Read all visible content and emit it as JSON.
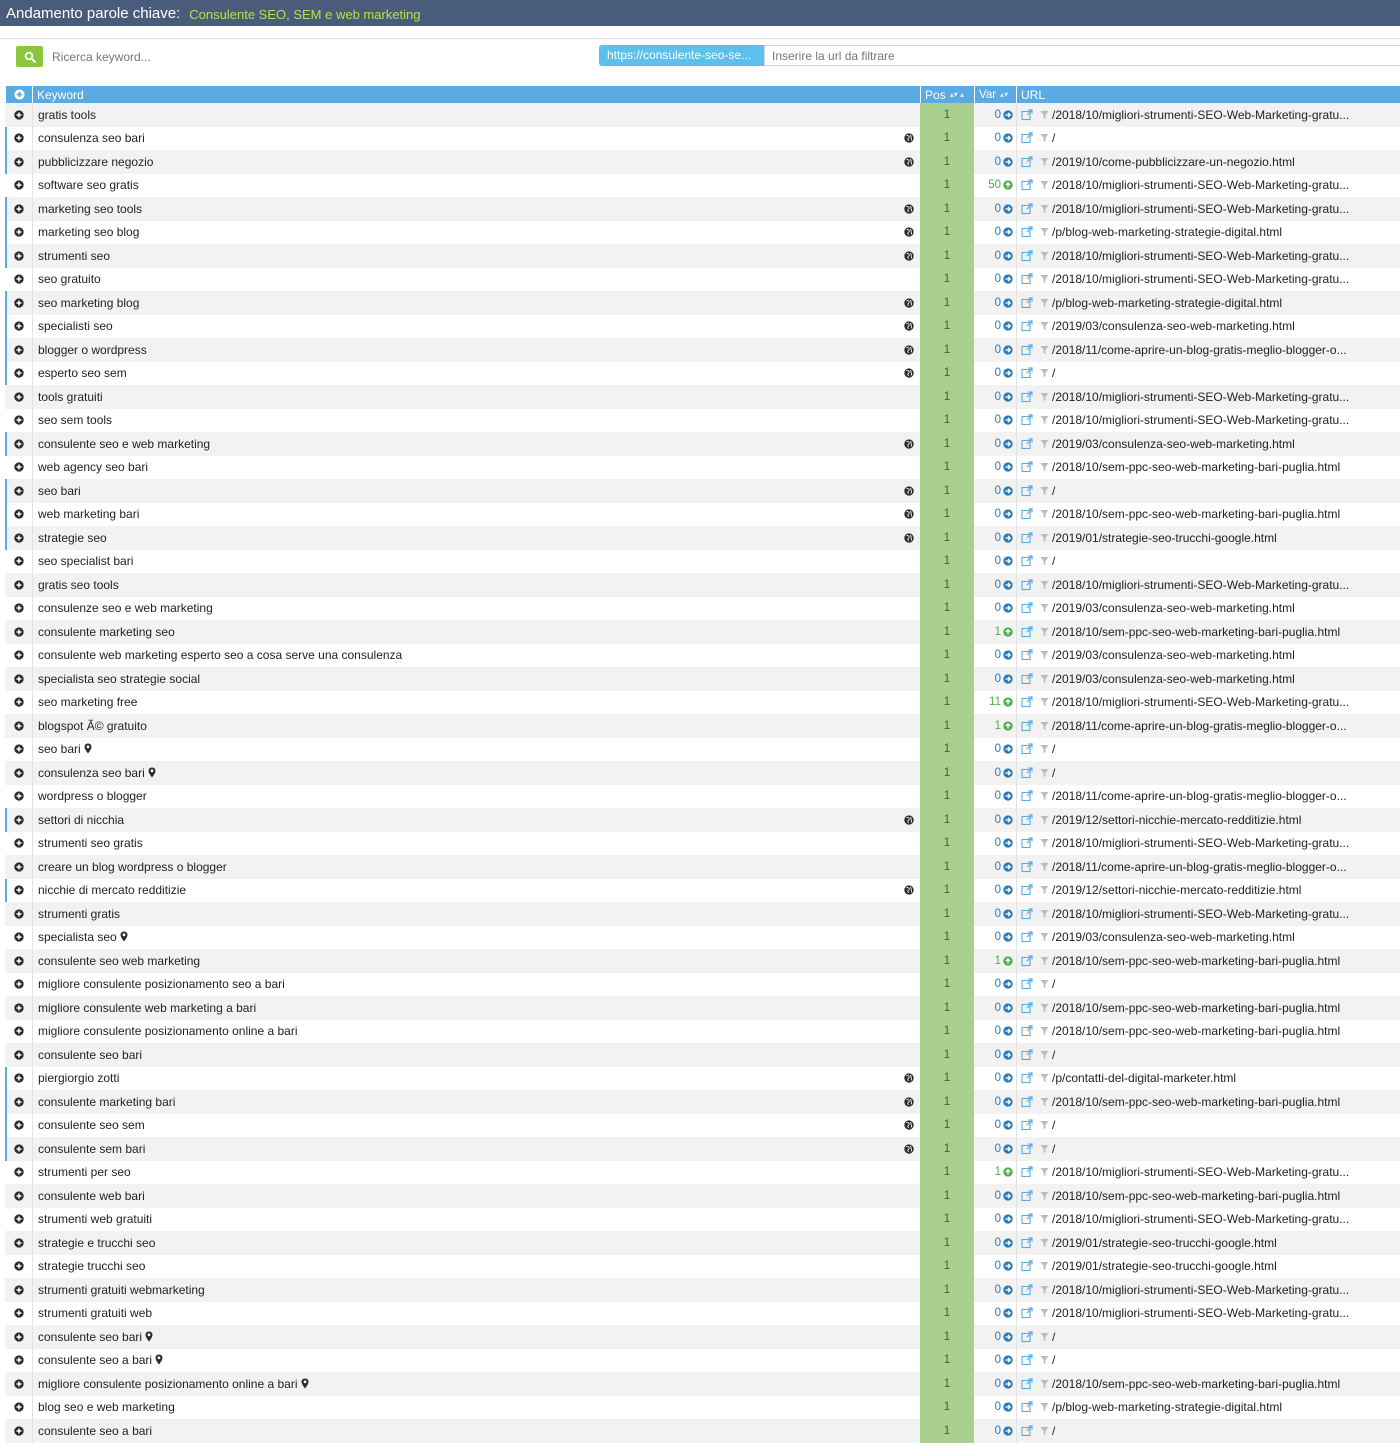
{
  "header": {
    "title": "Andamento parole chiave:",
    "project": "Consulente SEO, SEM e web marketing"
  },
  "filters": {
    "keyword_placeholder": "Ricerca keyword...",
    "domain_chip": "https://consulente-seo-se...",
    "url_placeholder": "Inserire la url da filtrare"
  },
  "columns": {
    "keyword": "Keyword",
    "pos": "Pos",
    "var": "Var",
    "url": "URL"
  },
  "icons": {
    "expand": "plus-circle-icon",
    "search": "search-icon",
    "globe": "globe-icon",
    "pin": "map-pin-icon",
    "var_same": "arrow-right-circle-icon",
    "var_up": "arrow-up-circle-icon",
    "open": "external-link-icon",
    "filter": "funnel-icon"
  },
  "colors": {
    "topbar": "#4a5c7c",
    "project": "#b4e04a",
    "header": "#5aaae3",
    "pos_bg": "#a9d08e",
    "var_up": "#4cae4c",
    "var_same": "#2a7ab8",
    "search_btn": "#8cc63f",
    "chip": "#5bc0eb"
  },
  "rows": [
    {
      "kw": "gratis tools",
      "pos": "1",
      "var": "0",
      "dir": "same",
      "url": "/2018/10/migliori-strumenti-SEO-Web-Marketing-gratu...",
      "globe": false,
      "pin": false,
      "hl": false
    },
    {
      "kw": "consulenza seo bari",
      "pos": "1",
      "var": "0",
      "dir": "same",
      "url": "/",
      "globe": true,
      "pin": false,
      "hl": true
    },
    {
      "kw": "pubblicizzare negozio",
      "pos": "1",
      "var": "0",
      "dir": "same",
      "url": "/2019/10/come-pubblicizzare-un-negozio.html",
      "globe": true,
      "pin": false,
      "hl": true
    },
    {
      "kw": "software seo gratis",
      "pos": "1",
      "var": "50",
      "dir": "up",
      "url": "/2018/10/migliori-strumenti-SEO-Web-Marketing-gratu...",
      "globe": false,
      "pin": false,
      "hl": false
    },
    {
      "kw": "marketing seo tools",
      "pos": "1",
      "var": "0",
      "dir": "same",
      "url": "/2018/10/migliori-strumenti-SEO-Web-Marketing-gratu...",
      "globe": true,
      "pin": false,
      "hl": true
    },
    {
      "kw": "marketing seo blog",
      "pos": "1",
      "var": "0",
      "dir": "same",
      "url": "/p/blog-web-marketing-strategie-digital.html",
      "globe": true,
      "pin": false,
      "hl": true
    },
    {
      "kw": "strumenti seo",
      "pos": "1",
      "var": "0",
      "dir": "same",
      "url": "/2018/10/migliori-strumenti-SEO-Web-Marketing-gratu...",
      "globe": true,
      "pin": false,
      "hl": true
    },
    {
      "kw": "seo gratuito",
      "pos": "1",
      "var": "0",
      "dir": "same",
      "url": "/2018/10/migliori-strumenti-SEO-Web-Marketing-gratu...",
      "globe": false,
      "pin": false,
      "hl": false
    },
    {
      "kw": "seo marketing blog",
      "pos": "1",
      "var": "0",
      "dir": "same",
      "url": "/p/blog-web-marketing-strategie-digital.html",
      "globe": true,
      "pin": false,
      "hl": true
    },
    {
      "kw": "specialisti seo",
      "pos": "1",
      "var": "0",
      "dir": "same",
      "url": "/2019/03/consulenza-seo-web-marketing.html",
      "globe": true,
      "pin": false,
      "hl": true
    },
    {
      "kw": "blogger o wordpress",
      "pos": "1",
      "var": "0",
      "dir": "same",
      "url": "/2018/11/come-aprire-un-blog-gratis-meglio-blogger-o...",
      "globe": true,
      "pin": false,
      "hl": true
    },
    {
      "kw": "esperto seo sem",
      "pos": "1",
      "var": "0",
      "dir": "same",
      "url": "/",
      "globe": true,
      "pin": false,
      "hl": true
    },
    {
      "kw": "tools gratuiti",
      "pos": "1",
      "var": "0",
      "dir": "same",
      "url": "/2018/10/migliori-strumenti-SEO-Web-Marketing-gratu...",
      "globe": false,
      "pin": false,
      "hl": false
    },
    {
      "kw": "seo sem tools",
      "pos": "1",
      "var": "0",
      "dir": "same",
      "url": "/2018/10/migliori-strumenti-SEO-Web-Marketing-gratu...",
      "globe": false,
      "pin": false,
      "hl": false
    },
    {
      "kw": "consulente seo e web marketing",
      "pos": "1",
      "var": "0",
      "dir": "same",
      "url": "/2019/03/consulenza-seo-web-marketing.html",
      "globe": true,
      "pin": false,
      "hl": true
    },
    {
      "kw": "web agency seo bari",
      "pos": "1",
      "var": "0",
      "dir": "same",
      "url": "/2018/10/sem-ppc-seo-web-marketing-bari-puglia.html",
      "globe": false,
      "pin": false,
      "hl": false
    },
    {
      "kw": "seo bari",
      "pos": "1",
      "var": "0",
      "dir": "same",
      "url": "/",
      "globe": true,
      "pin": false,
      "hl": true
    },
    {
      "kw": "web marketing bari",
      "pos": "1",
      "var": "0",
      "dir": "same",
      "url": "/2018/10/sem-ppc-seo-web-marketing-bari-puglia.html",
      "globe": true,
      "pin": false,
      "hl": true
    },
    {
      "kw": "strategie seo",
      "pos": "1",
      "var": "0",
      "dir": "same",
      "url": "/2019/01/strategie-seo-trucchi-google.html",
      "globe": true,
      "pin": false,
      "hl": true
    },
    {
      "kw": "seo specialist bari",
      "pos": "1",
      "var": "0",
      "dir": "same",
      "url": "/",
      "globe": false,
      "pin": false,
      "hl": false
    },
    {
      "kw": "gratis seo tools",
      "pos": "1",
      "var": "0",
      "dir": "same",
      "url": "/2018/10/migliori-strumenti-SEO-Web-Marketing-gratu...",
      "globe": false,
      "pin": false,
      "hl": false
    },
    {
      "kw": "consulenze seo e web marketing",
      "pos": "1",
      "var": "0",
      "dir": "same",
      "url": "/2019/03/consulenza-seo-web-marketing.html",
      "globe": false,
      "pin": false,
      "hl": false
    },
    {
      "kw": "consulente marketing seo",
      "pos": "1",
      "var": "1",
      "dir": "up",
      "url": "/2018/10/sem-ppc-seo-web-marketing-bari-puglia.html",
      "globe": false,
      "pin": false,
      "hl": false
    },
    {
      "kw": "consulente web marketing esperto seo a cosa serve una consulenza",
      "pos": "1",
      "var": "0",
      "dir": "same",
      "url": "/2019/03/consulenza-seo-web-marketing.html",
      "globe": false,
      "pin": false,
      "hl": false
    },
    {
      "kw": "specialista seo strategie social",
      "pos": "1",
      "var": "0",
      "dir": "same",
      "url": "/2019/03/consulenza-seo-web-marketing.html",
      "globe": false,
      "pin": false,
      "hl": false
    },
    {
      "kw": "seo marketing free",
      "pos": "1",
      "var": "11",
      "dir": "up",
      "url": "/2018/10/migliori-strumenti-SEO-Web-Marketing-gratu...",
      "globe": false,
      "pin": false,
      "hl": false
    },
    {
      "kw": "blogspot Ã© gratuito",
      "pos": "1",
      "var": "1",
      "dir": "up",
      "url": "/2018/11/come-aprire-un-blog-gratis-meglio-blogger-o...",
      "globe": false,
      "pin": false,
      "hl": false
    },
    {
      "kw": "seo bari",
      "pos": "1",
      "var": "0",
      "dir": "same",
      "url": "/",
      "globe": false,
      "pin": true,
      "hl": false
    },
    {
      "kw": "consulenza seo bari",
      "pos": "1",
      "var": "0",
      "dir": "same",
      "url": "/",
      "globe": false,
      "pin": true,
      "hl": false
    },
    {
      "kw": "wordpress o blogger",
      "pos": "1",
      "var": "0",
      "dir": "same",
      "url": "/2018/11/come-aprire-un-blog-gratis-meglio-blogger-o...",
      "globe": false,
      "pin": false,
      "hl": false
    },
    {
      "kw": "settori di nicchia",
      "pos": "1",
      "var": "0",
      "dir": "same",
      "url": "/2019/12/settori-nicchie-mercato-redditizie.html",
      "globe": true,
      "pin": false,
      "hl": true
    },
    {
      "kw": "strumenti seo gratis",
      "pos": "1",
      "var": "0",
      "dir": "same",
      "url": "/2018/10/migliori-strumenti-SEO-Web-Marketing-gratu...",
      "globe": false,
      "pin": false,
      "hl": false
    },
    {
      "kw": "creare un blog wordpress o blogger",
      "pos": "1",
      "var": "0",
      "dir": "same",
      "url": "/2018/11/come-aprire-un-blog-gratis-meglio-blogger-o...",
      "globe": false,
      "pin": false,
      "hl": false
    },
    {
      "kw": "nicchie di mercato redditizie",
      "pos": "1",
      "var": "0",
      "dir": "same",
      "url": "/2019/12/settori-nicchie-mercato-redditizie.html",
      "globe": true,
      "pin": false,
      "hl": true
    },
    {
      "kw": "strumenti gratis",
      "pos": "1",
      "var": "0",
      "dir": "same",
      "url": "/2018/10/migliori-strumenti-SEO-Web-Marketing-gratu...",
      "globe": false,
      "pin": false,
      "hl": false
    },
    {
      "kw": "specialista seo",
      "pos": "1",
      "var": "0",
      "dir": "same",
      "url": "/2019/03/consulenza-seo-web-marketing.html",
      "globe": false,
      "pin": true,
      "hl": false
    },
    {
      "kw": "consulente seo web marketing",
      "pos": "1",
      "var": "1",
      "dir": "up",
      "url": "/2018/10/sem-ppc-seo-web-marketing-bari-puglia.html",
      "globe": false,
      "pin": false,
      "hl": false
    },
    {
      "kw": "migliore consulente posizionamento seo a bari",
      "pos": "1",
      "var": "0",
      "dir": "same",
      "url": "/",
      "globe": false,
      "pin": false,
      "hl": false
    },
    {
      "kw": "migliore consulente web marketing a bari",
      "pos": "1",
      "var": "0",
      "dir": "same",
      "url": "/2018/10/sem-ppc-seo-web-marketing-bari-puglia.html",
      "globe": false,
      "pin": false,
      "hl": false
    },
    {
      "kw": "migliore consulente posizionamento online a bari",
      "pos": "1",
      "var": "0",
      "dir": "same",
      "url": "/2018/10/sem-ppc-seo-web-marketing-bari-puglia.html",
      "globe": false,
      "pin": false,
      "hl": false
    },
    {
      "kw": "consulente seo bari",
      "pos": "1",
      "var": "0",
      "dir": "same",
      "url": "/",
      "globe": false,
      "pin": false,
      "hl": false
    },
    {
      "kw": "piergiorgio zotti",
      "pos": "1",
      "var": "0",
      "dir": "same",
      "url": "/p/contatti-del-digital-marketer.html",
      "globe": true,
      "pin": false,
      "hl": true
    },
    {
      "kw": "consulente marketing bari",
      "pos": "1",
      "var": "0",
      "dir": "same",
      "url": "/2018/10/sem-ppc-seo-web-marketing-bari-puglia.html",
      "globe": true,
      "pin": false,
      "hl": true
    },
    {
      "kw": "consulente seo sem",
      "pos": "1",
      "var": "0",
      "dir": "same",
      "url": "/",
      "globe": true,
      "pin": false,
      "hl": true
    },
    {
      "kw": "consulente sem bari",
      "pos": "1",
      "var": "0",
      "dir": "same",
      "url": "/",
      "globe": true,
      "pin": false,
      "hl": true
    },
    {
      "kw": "strumenti per seo",
      "pos": "1",
      "var": "1",
      "dir": "up",
      "url": "/2018/10/migliori-strumenti-SEO-Web-Marketing-gratu...",
      "globe": false,
      "pin": false,
      "hl": false
    },
    {
      "kw": "consulente web bari",
      "pos": "1",
      "var": "0",
      "dir": "same",
      "url": "/2018/10/sem-ppc-seo-web-marketing-bari-puglia.html",
      "globe": false,
      "pin": false,
      "hl": false
    },
    {
      "kw": "strumenti web gratuiti",
      "pos": "1",
      "var": "0",
      "dir": "same",
      "url": "/2018/10/migliori-strumenti-SEO-Web-Marketing-gratu...",
      "globe": false,
      "pin": false,
      "hl": false
    },
    {
      "kw": "strategie e trucchi seo",
      "pos": "1",
      "var": "0",
      "dir": "same",
      "url": "/2019/01/strategie-seo-trucchi-google.html",
      "globe": false,
      "pin": false,
      "hl": false
    },
    {
      "kw": "strategie trucchi seo",
      "pos": "1",
      "var": "0",
      "dir": "same",
      "url": "/2019/01/strategie-seo-trucchi-google.html",
      "globe": false,
      "pin": false,
      "hl": false
    },
    {
      "kw": "strumenti gratuiti webmarketing",
      "pos": "1",
      "var": "0",
      "dir": "same",
      "url": "/2018/10/migliori-strumenti-SEO-Web-Marketing-gratu...",
      "globe": false,
      "pin": false,
      "hl": false
    },
    {
      "kw": "strumenti gratuiti web",
      "pos": "1",
      "var": "0",
      "dir": "same",
      "url": "/2018/10/migliori-strumenti-SEO-Web-Marketing-gratu...",
      "globe": false,
      "pin": false,
      "hl": false
    },
    {
      "kw": "consulente seo bari",
      "pos": "1",
      "var": "0",
      "dir": "same",
      "url": "/",
      "globe": false,
      "pin": true,
      "hl": false
    },
    {
      "kw": "consulente seo a bari",
      "pos": "1",
      "var": "0",
      "dir": "same",
      "url": "/",
      "globe": false,
      "pin": true,
      "hl": false
    },
    {
      "kw": "migliore consulente posizionamento online a bari",
      "pos": "1",
      "var": "0",
      "dir": "same",
      "url": "/2018/10/sem-ppc-seo-web-marketing-bari-puglia.html",
      "globe": false,
      "pin": true,
      "hl": false
    },
    {
      "kw": "blog seo e web marketing",
      "pos": "1",
      "var": "0",
      "dir": "same",
      "url": "/p/blog-web-marketing-strategie-digital.html",
      "globe": false,
      "pin": false,
      "hl": false
    },
    {
      "kw": "consulente seo a bari",
      "pos": "1",
      "var": "0",
      "dir": "same",
      "url": "/",
      "globe": false,
      "pin": false,
      "hl": false
    }
  ]
}
